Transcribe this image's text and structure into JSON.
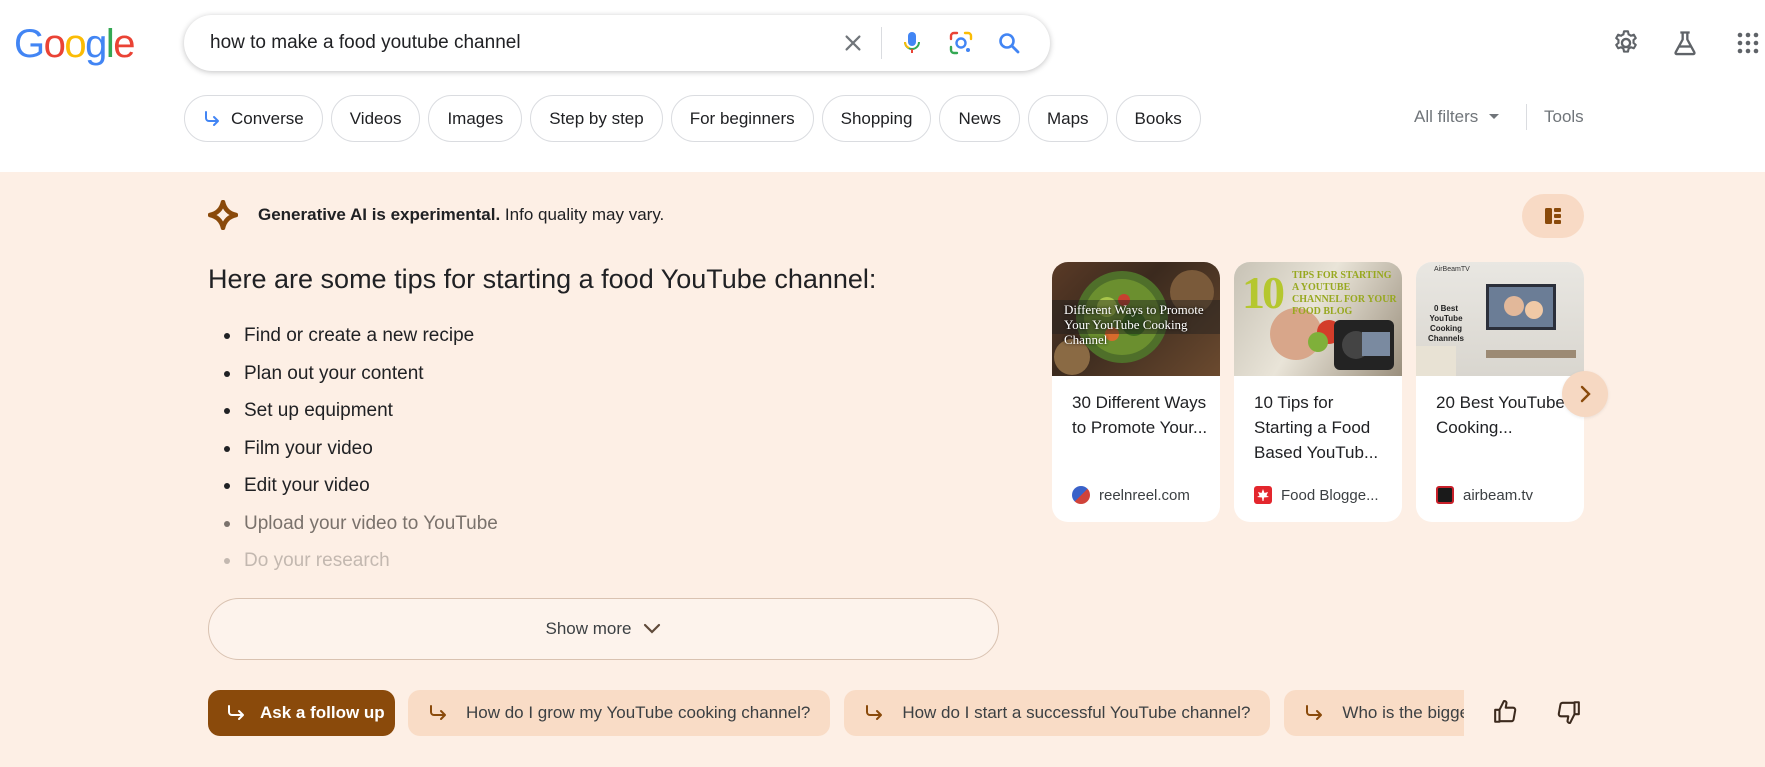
{
  "logo": {
    "letters": [
      "G",
      "o",
      "o",
      "g",
      "l",
      "e"
    ],
    "colors": [
      "#4285f4",
      "#ea4335",
      "#fbbc05",
      "#4285f4",
      "#34a853",
      "#ea4335"
    ]
  },
  "search": {
    "query": "how to make a food youtube channel"
  },
  "chips": [
    {
      "label": "Converse",
      "arrow": true
    },
    {
      "label": "Videos"
    },
    {
      "label": "Images"
    },
    {
      "label": "Step by step"
    },
    {
      "label": "For beginners"
    },
    {
      "label": "Shopping"
    },
    {
      "label": "News"
    },
    {
      "label": "Maps"
    },
    {
      "label": "Books"
    }
  ],
  "filters": {
    "all_filters": "All filters",
    "tools": "Tools"
  },
  "ai": {
    "notice_bold": "Generative AI is experimental.",
    "notice_rest": " Info quality may vary.",
    "title": "Here are some tips for starting a food YouTube channel:",
    "tips": [
      "Find or create a new recipe",
      "Plan out your content",
      "Set up equipment",
      "Film your video",
      "Edit your video",
      "Upload your video to YouTube",
      "Do your research"
    ],
    "show_more": "Show more"
  },
  "cards": [
    {
      "title": "30 Different Ways to Promote Your...",
      "source": "reelnreel.com",
      "img_text": "Different Ways to Promote Your YouTube Cooking Channel"
    },
    {
      "title": "10 Tips for Starting a Food Based YouTub...",
      "source": "Food Blogge...",
      "img_text": "TIPS FOR STARTING A YOUTUBE CHANNEL FOR YOUR FOOD BLOG",
      "img_num": "10"
    },
    {
      "title": "20 Best YouTube Cooking...",
      "source": "airbeam.tv",
      "img_text": "0 Best YouTube Cooking Channels",
      "img_brand": "AirBeamTV"
    }
  ],
  "followup": {
    "ask": "Ask a follow up",
    "suggestions": [
      "How do I grow my YouTube cooking channel?",
      "How do I start a successful YouTube channel?",
      "Who is the biggest food YouTuber?"
    ]
  },
  "colors": {
    "accent_brown": "#8a4a0b",
    "panel_bg": "#fdefe5",
    "blue": "#4285f4"
  }
}
